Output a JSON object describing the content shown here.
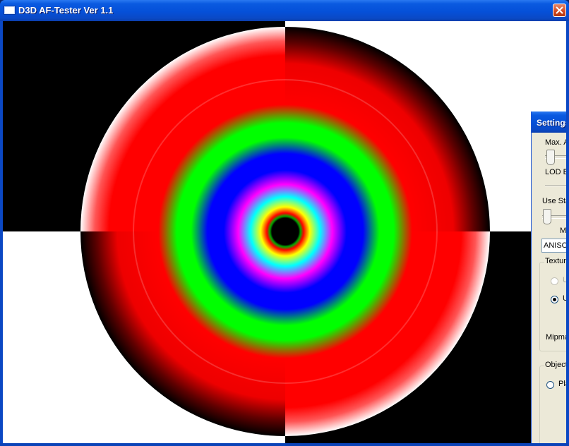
{
  "window": {
    "title": "D3D AF-Tester Ver 1.1",
    "icons": {
      "app": "window-icon",
      "close": "close-icon"
    }
  },
  "scene": {
    "background_colors": [
      "#000000",
      "#ffffff"
    ],
    "ring_colors": [
      "#ff0000",
      "#00ff00",
      "#0000ff",
      "#ff00ff",
      "#00ffff",
      "#ffff00"
    ]
  },
  "settings": {
    "title": "Settings",
    "max_aniso_label": "Max. An",
    "lod_bias_label": "LOD Bi",
    "use_stage_label": "Use Sta",
    "min_filter_label": "Mi",
    "filter_combo_value": "ANISOT",
    "texture_group": {
      "title": "Texture",
      "options": [
        {
          "label": "U",
          "selected": false,
          "enabled": false
        },
        {
          "label": "U",
          "selected": true,
          "enabled": true
        }
      ],
      "mipmap_label": "Mipmap"
    },
    "objects_group": {
      "title": "Objects",
      "options": [
        {
          "label": "Plan",
          "selected": false,
          "enabled": true
        }
      ]
    }
  }
}
